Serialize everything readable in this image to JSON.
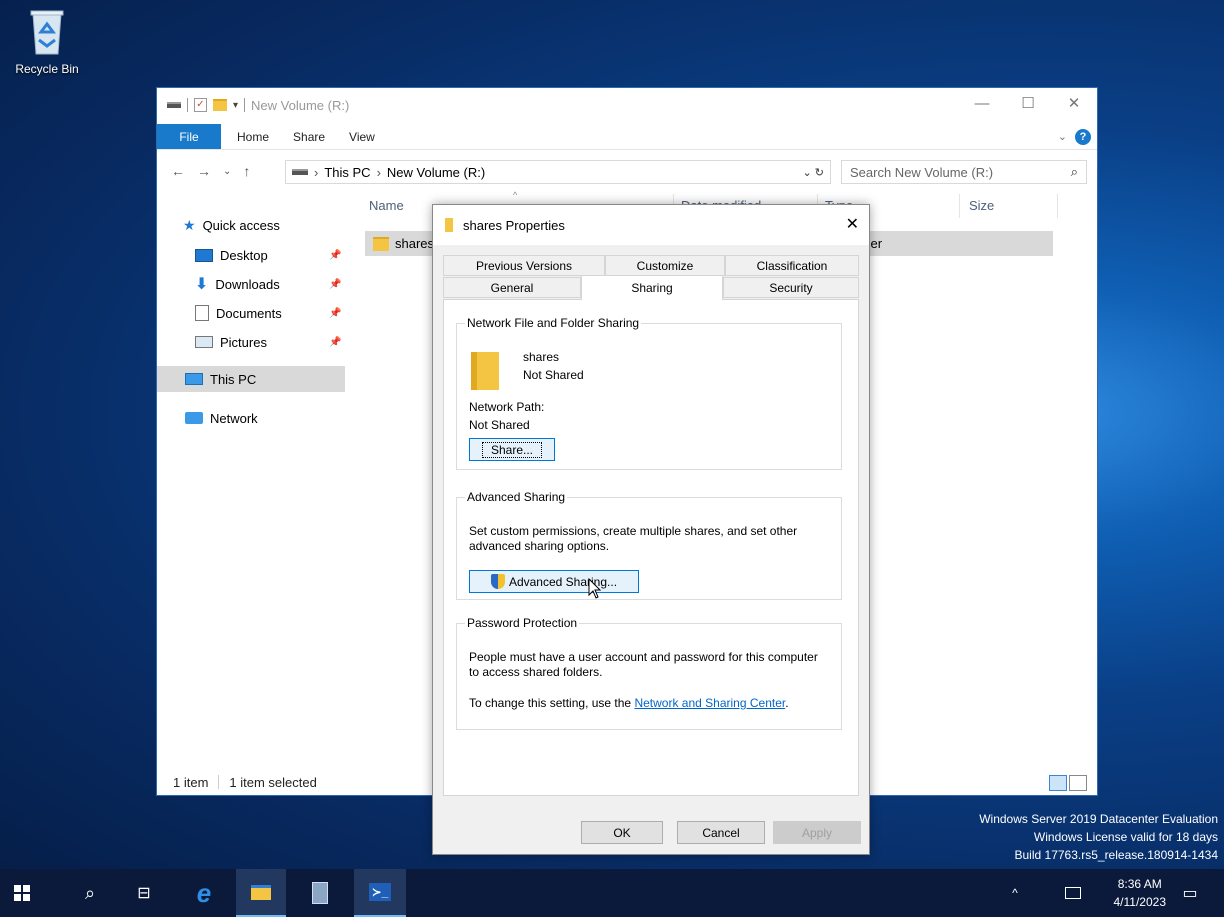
{
  "desktop": {
    "recycle_bin_label": "Recycle Bin"
  },
  "explorer": {
    "title": "New Volume (R:)",
    "ribbon_tabs": {
      "file": "File",
      "home": "Home",
      "share": "Share",
      "view": "View"
    },
    "breadcrumb": {
      "this_pc": "This PC",
      "volume": "New Volume (R:)"
    },
    "search_placeholder": "Search New Volume (R:)",
    "nav": {
      "quick_access": "Quick access",
      "desktop": "Desktop",
      "downloads": "Downloads",
      "documents": "Documents",
      "pictures": "Pictures",
      "this_pc": "This PC",
      "network": "Network"
    },
    "columns": {
      "name": "Name",
      "date_modified": "Date modified",
      "type": "Type",
      "size": "Size"
    },
    "file_row": {
      "name": "shares",
      "type": "File folder"
    },
    "status": {
      "items": "1 item",
      "selected": "1 item selected"
    }
  },
  "dialog": {
    "title": "shares Properties",
    "tabs_top": [
      "Previous Versions",
      "Customize",
      "Classification"
    ],
    "tabs_bottom": [
      "General",
      "Sharing",
      "Security"
    ],
    "network_sharing": {
      "legend": "Network File and Folder Sharing",
      "folder_name": "shares",
      "folder_state": "Not Shared",
      "path_label": "Network Path:",
      "path_value": "Not Shared",
      "share_button": "Share..."
    },
    "advanced_sharing": {
      "legend": "Advanced Sharing",
      "description": "Set custom permissions, create multiple shares, and set other advanced sharing options.",
      "button": "Advanced Sharing..."
    },
    "password_protection": {
      "legend": "Password Protection",
      "description": "People must have a user account and password for this computer to access shared folders.",
      "change_prefix": "To change this setting, use the ",
      "link": "Network and Sharing Center",
      "change_suffix": "."
    },
    "buttons": {
      "ok": "OK",
      "cancel": "Cancel",
      "apply": "Apply"
    }
  },
  "watermark": {
    "line1": "Windows Server 2019 Datacenter Evaluation",
    "line2": "Windows License valid for 18 days",
    "line3": "Build 17763.rs5_release.180914-1434"
  },
  "taskbar": {
    "time": "8:36 AM",
    "date": "4/11/2023"
  },
  "colors": {
    "accent": "#1979ca",
    "selection": "#d9d9d9",
    "link": "#0066cc"
  }
}
